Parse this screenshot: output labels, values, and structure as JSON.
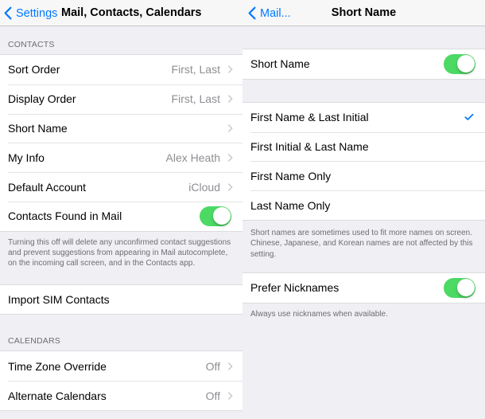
{
  "left": {
    "nav": {
      "back_label": "Settings",
      "title": "Mail, Contacts, Calendars"
    },
    "contacts": {
      "header": "CONTACTS",
      "rows": [
        {
          "label": "Sort Order",
          "value": "First, Last"
        },
        {
          "label": "Display Order",
          "value": "First, Last"
        },
        {
          "label": "Short Name",
          "value": ""
        },
        {
          "label": "My Info",
          "value": "Alex Heath"
        },
        {
          "label": "Default Account",
          "value": "iCloud"
        }
      ],
      "toggle_row": {
        "label": "Contacts Found in Mail",
        "on": true
      },
      "footer": "Turning this off will delete any unconfirmed contact suggestions and prevent suggestions from appearing in Mail autocomplete, on the incoming call screen, and in the Contacts app."
    },
    "import": {
      "label": "Import SIM Contacts"
    },
    "calendars": {
      "header": "CALENDARS",
      "rows": [
        {
          "label": "Time Zone Override",
          "value": "Off"
        },
        {
          "label": "Alternate Calendars",
          "value": "Off"
        }
      ]
    }
  },
  "right": {
    "nav": {
      "back_label": "Mail...",
      "title": "Short Name"
    },
    "short_name_toggle": {
      "label": "Short Name",
      "on": true
    },
    "options": [
      {
        "label": "First Name & Last Initial",
        "selected": true
      },
      {
        "label": "First Initial & Last Name",
        "selected": false
      },
      {
        "label": "First Name Only",
        "selected": false
      },
      {
        "label": "Last Name Only",
        "selected": false
      }
    ],
    "options_footer": "Short names are sometimes used to fit more names on screen. Chinese, Japanese, and Korean names are not affected by this setting.",
    "nicknames_toggle": {
      "label": "Prefer Nicknames",
      "on": true
    },
    "nicknames_footer": "Always use nicknames when available."
  },
  "colors": {
    "accent": "#007aff",
    "toggle_on": "#4cd964",
    "background": "#efeff4"
  }
}
